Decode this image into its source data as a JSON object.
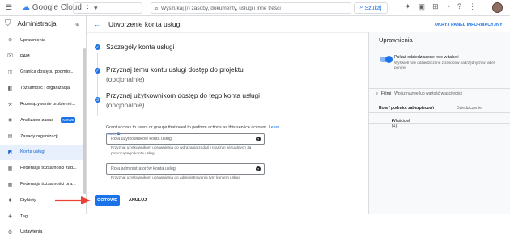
{
  "topbar": {
    "logo_text": "Google Cloud",
    "search_placeholder": "Wyszukaj (/) zasoby, dokumenty, usługi i inne treści",
    "search_button": "Szukaj"
  },
  "sidebar": {
    "title": "Administracja",
    "items": [
      {
        "label": "Uprawnienia",
        "icon": "person-add-icon"
      },
      {
        "label": "PAM",
        "icon": "lock-icon"
      },
      {
        "label": "Granica dostępu podmiot...",
        "icon": "boundary-icon"
      },
      {
        "label": "Tożsamość i organizacja",
        "icon": "identity-icon"
      },
      {
        "label": "Rozwiązywanie problemó...",
        "icon": "wrench-icon"
      },
      {
        "label": "Analizator zasad",
        "icon": "analyzer-icon",
        "badge": "NOWE"
      },
      {
        "label": "Zasady organizacji",
        "icon": "document-icon"
      },
      {
        "label": "Konta usługi",
        "icon": "service-account-icon",
        "active": true
      },
      {
        "label": "Federacja tożsamości zad...",
        "icon": "federation-icon"
      },
      {
        "label": "Federacja tożsamości pra...",
        "icon": "federation-icon"
      },
      {
        "label": "Etykiety",
        "icon": "label-icon"
      },
      {
        "label": "Tagi",
        "icon": "tag-icon"
      },
      {
        "label": "Ustawienia",
        "icon": "gear-icon"
      }
    ]
  },
  "main": {
    "page_title": "Utworzenie konta usługi",
    "step1_title": "Szczegóły konta usługi",
    "step2_title": "Przyznaj temu kontu usługi dostęp do projektu",
    "step2_sub": "(opcjonalnie)",
    "step3_number": "3",
    "step3_title": "Przyznaj użytkownikom dostęp do tego konta usługi",
    "step3_sub": "(opcjonalnie)",
    "description": "Grant access to users or groups that need to perform actions as this service account.",
    "learn_more": "Learn more",
    "field1_label": "Rola użytkowników konta usługi",
    "field1_hint": "Przyznaj użytkownikom uprawnienia do wdrażania zadań i maszyn wirtualnych za pomocą tego konta usługi",
    "field2_label": "Rola administratorów konta usługi",
    "field2_hint": "Przyznaj użytkownikom uprawnienia do administrowania tym kontem usługi",
    "done_button": "GOTOWE",
    "cancel_button": "ANULUJ"
  },
  "info_panel": {
    "link_text": "UKRYJ PANEL INFORMACYJNY",
    "title": "Uprawnienia",
    "toggle_label": "Pokaż odziedziczone role w tabeli",
    "toggle_sub": "Wyświetl role odziedziczone z zasobów nadrzędnych w tabeli poniżej",
    "toggle_on": true,
    "filter_label": "Filtruj",
    "filter_placeholder": "Wpisz nazwę lub wartość właściwości",
    "col1": "Rola / podmiot zabezpieczeń",
    "col2": "Dziedziczenie",
    "row1": "Właściciel (1)"
  },
  "colors": {
    "accent": "#1a73e8",
    "arrow": "#ea4335"
  }
}
